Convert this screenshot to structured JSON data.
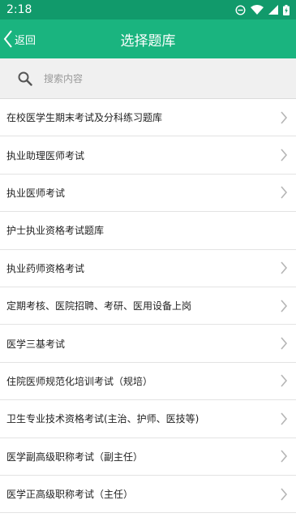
{
  "status": {
    "time": "2:18"
  },
  "header": {
    "back_label": "返回",
    "title": "选择题库"
  },
  "search": {
    "placeholder": "搜索内容"
  },
  "items": [
    {
      "label": "在校医学生期末考试及分科练习题库",
      "chevron": true
    },
    {
      "label": "执业助理医师考试",
      "chevron": true
    },
    {
      "label": "执业医师考试",
      "chevron": true
    },
    {
      "label": "护士执业资格考试题库",
      "chevron": false
    },
    {
      "label": "执业药师资格考试",
      "chevron": true
    },
    {
      "label": "定期考核、医院招聘、考研、医用设备上岗",
      "chevron": true
    },
    {
      "label": "医学三基考试",
      "chevron": true
    },
    {
      "label": "住院医师规范化培训考试（规培）",
      "chevron": true
    },
    {
      "label": "卫生专业技术资格考试(主治、护师、医技等)",
      "chevron": true
    },
    {
      "label": "医学副高级职称考试（副主任）",
      "chevron": true
    },
    {
      "label": "医学正高级职称考试（主任）",
      "chevron": true
    }
  ],
  "colors": {
    "statusbar": "#119a6b",
    "appbar": "#1ab47f"
  }
}
